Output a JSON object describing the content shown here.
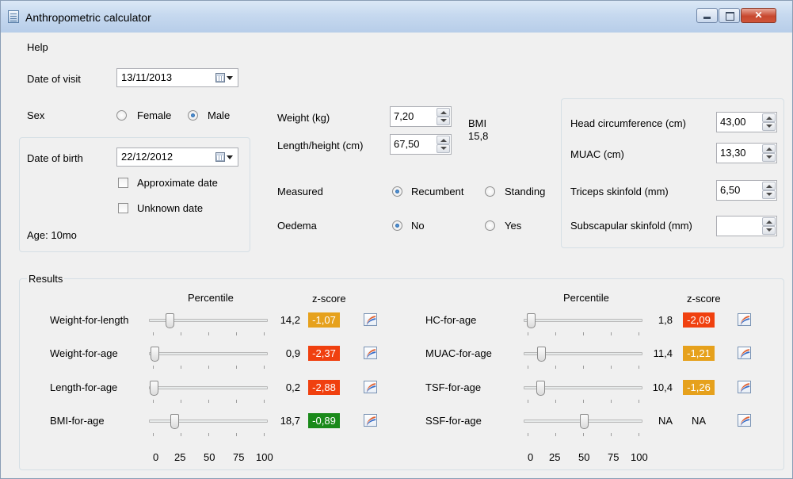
{
  "window": {
    "title": "Anthropometric calculator",
    "menu": [
      "Help"
    ]
  },
  "visit": {
    "date_label": "Date of visit",
    "date_value": "13/11/2013"
  },
  "sex": {
    "label": "Sex",
    "options": [
      "Female",
      "Male"
    ],
    "selected": "Male"
  },
  "birth": {
    "date_label": "Date of birth",
    "date_value": "22/12/2012",
    "approximate_label": "Approximate date",
    "approximate_checked": false,
    "unknown_label": "Unknown date",
    "unknown_checked": false,
    "age_text": "Age: 10mo"
  },
  "measures": {
    "weight_label": "Weight (kg)",
    "weight_value": "7,20",
    "length_label": "Length/height (cm)",
    "length_value": "67,50",
    "bmi_label": "BMI",
    "bmi_value": "15,8",
    "measured_label": "Measured",
    "measured_options": [
      "Recumbent",
      "Standing"
    ],
    "measured_selected": "Recumbent",
    "oedema_label": "Oedema",
    "oedema_options": [
      "No",
      "Yes"
    ],
    "oedema_selected": "No"
  },
  "extra": {
    "head_label": "Head circumference (cm)",
    "head_value": "43,00",
    "muac_label": "MUAC (cm)",
    "muac_value": "13,30",
    "triceps_label": "Triceps skinfold (mm)",
    "triceps_value": "6,50",
    "subscap_label": "Subscapular skinfold (mm)",
    "subscap_value": ""
  },
  "results": {
    "group_label": "Results",
    "percentile_header": "Percentile",
    "zscore_header": "z-score",
    "scale_labels": [
      "0",
      "25",
      "50",
      "75",
      "100"
    ],
    "colors": {
      "orange": "#e6a11c",
      "red": "#f0400f",
      "green": "#1a8a1a"
    },
    "left": [
      {
        "name": "Weight-for-length",
        "percentile": "14,2",
        "percentile_num": 14.2,
        "zscore": "-1,07",
        "zcolor": "#e6a11c"
      },
      {
        "name": "Weight-for-age",
        "percentile": "0,9",
        "percentile_num": 0.9,
        "zscore": "-2,37",
        "zcolor": "#f0400f"
      },
      {
        "name": "Length-for-age",
        "percentile": "0,2",
        "percentile_num": 0.2,
        "zscore": "-2,88",
        "zcolor": "#f0400f"
      },
      {
        "name": "BMI-for-age",
        "percentile": "18,7",
        "percentile_num": 18.7,
        "zscore": "-0,89",
        "zcolor": "#1a8a1a"
      }
    ],
    "right": [
      {
        "name": "HC-for-age",
        "percentile": "1,8",
        "percentile_num": 1.8,
        "zscore": "-2,09",
        "zcolor": "#f0400f"
      },
      {
        "name": "MUAC-for-age",
        "percentile": "11,4",
        "percentile_num": 11.4,
        "zscore": "-1,21",
        "zcolor": "#e6a11c"
      },
      {
        "name": "TSF-for-age",
        "percentile": "10,4",
        "percentile_num": 10.4,
        "zscore": "-1,26",
        "zcolor": "#e6a11c"
      },
      {
        "name": "SSF-for-age",
        "percentile": "NA",
        "percentile_num": 50,
        "zscore": "NA",
        "zcolor": ""
      }
    ],
    "chart_icon": "growth-chart-icon"
  }
}
